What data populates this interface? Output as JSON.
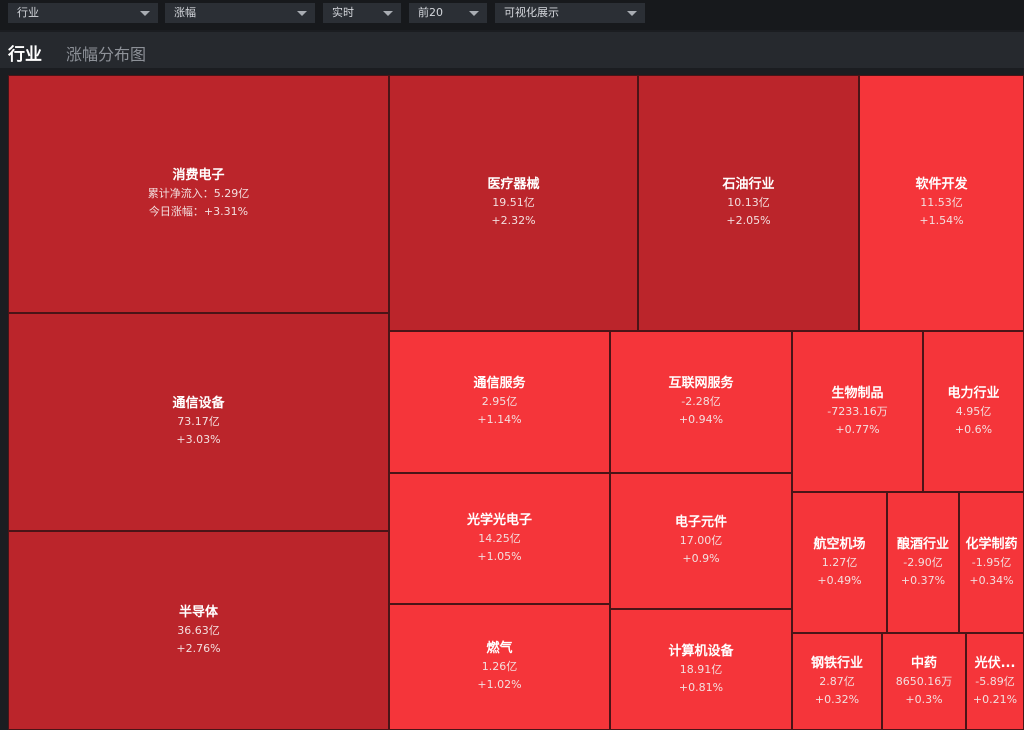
{
  "filters": [
    {
      "label": "行业"
    },
    {
      "label": "涨幅"
    },
    {
      "label": "实时"
    },
    {
      "label": "前20"
    },
    {
      "label": "可视化展示"
    }
  ],
  "header": {
    "title": "行业",
    "subtitle": "涨幅分布图"
  },
  "colors": {
    "dark_red": "#bb252b",
    "bright_red": "#f5353a",
    "border": "#4a1417"
  },
  "treemap": {
    "featured": {
      "name": "消费电子",
      "inflow_label": "累计净流入：5.29亿",
      "change_label": "今日涨幅：+3.31%"
    },
    "tiles": [
      {
        "name": "通信设备",
        "inflow": "73.17亿",
        "change": "+3.03%"
      },
      {
        "name": "半导体",
        "inflow": "36.63亿",
        "change": "+2.76%"
      },
      {
        "name": "医疗器械",
        "inflow": "19.51亿",
        "change": "+2.32%"
      },
      {
        "name": "石油行业",
        "inflow": "10.13亿",
        "change": "+2.05%"
      },
      {
        "name": "软件开发",
        "inflow": "11.53亿",
        "change": "+1.54%"
      },
      {
        "name": "通信服务",
        "inflow": "2.95亿",
        "change": "+1.14%"
      },
      {
        "name": "互联网服务",
        "inflow": "-2.28亿",
        "change": "+0.94%"
      },
      {
        "name": "生物制品",
        "inflow": "-7233.16万",
        "change": "+0.77%"
      },
      {
        "name": "电力行业",
        "inflow": "4.95亿",
        "change": "+0.6%"
      },
      {
        "name": "光学光电子",
        "inflow": "14.25亿",
        "change": "+1.05%"
      },
      {
        "name": "电子元件",
        "inflow": "17.00亿",
        "change": "+0.9%"
      },
      {
        "name": "航空机场",
        "inflow": "1.27亿",
        "change": "+0.49%"
      },
      {
        "name": "酿酒行业",
        "inflow": "-2.90亿",
        "change": "+0.37%"
      },
      {
        "name": "化学制药",
        "inflow": "-1.95亿",
        "change": "+0.34%"
      },
      {
        "name": "燃气",
        "inflow": "1.26亿",
        "change": "+1.02%"
      },
      {
        "name": "计算机设备",
        "inflow": "18.91亿",
        "change": "+0.81%"
      },
      {
        "name": "钢铁行业",
        "inflow": "2.87亿",
        "change": "+0.32%"
      },
      {
        "name": "中药",
        "inflow": "8650.16万",
        "change": "+0.3%"
      },
      {
        "name": "光伏...",
        "inflow": "-5.89亿",
        "change": "+0.21%"
      }
    ]
  }
}
